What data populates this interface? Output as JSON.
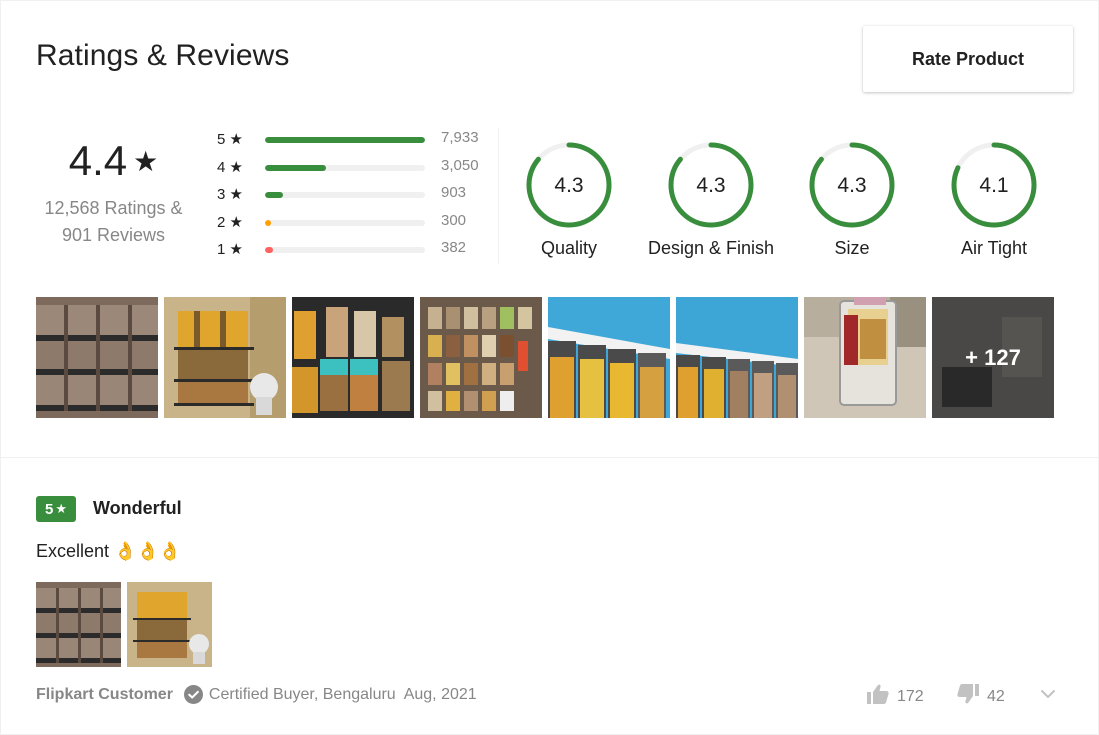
{
  "header": {
    "title": "Ratings & Reviews",
    "rate_button": "Rate Product"
  },
  "overall": {
    "value": "4.4",
    "star": "★",
    "ratings_text": "12,568 Ratings &",
    "reviews_text": "901 Reviews"
  },
  "distribution": [
    {
      "label": "5 ★",
      "count": "7,933",
      "fraction": 1.0,
      "color": "#388e3c"
    },
    {
      "label": "4 ★",
      "count": "3,050",
      "fraction": 0.38,
      "color": "#388e3c"
    },
    {
      "label": "3 ★",
      "count": "903",
      "fraction": 0.11,
      "color": "#388e3c"
    },
    {
      "label": "2 ★",
      "count": "300",
      "fraction": 0.04,
      "color": "#ff9f00"
    },
    {
      "label": "1 ★",
      "count": "382",
      "fraction": 0.05,
      "color": "#ff6161"
    }
  ],
  "aspects": [
    {
      "label": "Quality",
      "value": "4.3",
      "fraction": 0.86
    },
    {
      "label": "Design & Finish",
      "value": "4.3",
      "fraction": 0.86
    },
    {
      "label": "Size",
      "value": "4.3",
      "fraction": 0.86
    },
    {
      "label": "Air Tight",
      "value": "4.1",
      "fraction": 0.82
    }
  ],
  "aspect_color": "#388e3c",
  "photos": {
    "more_label": "+ 127"
  },
  "review": {
    "rating": "5",
    "star": "★",
    "title": "Wonderful",
    "body": "Excellent 👌👌👌",
    "author": "Flipkart Customer",
    "certified": "Certified Buyer, Bengaluru",
    "date": "Aug, 2021",
    "likes": "172",
    "dislikes": "42"
  }
}
